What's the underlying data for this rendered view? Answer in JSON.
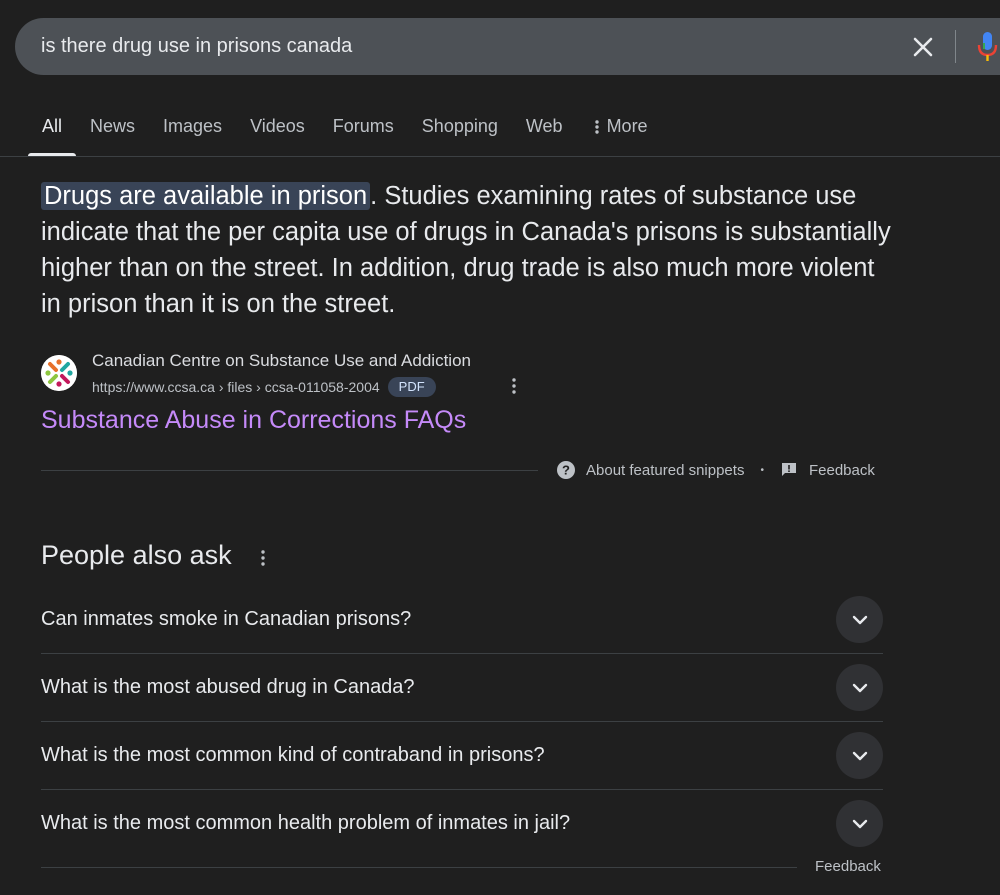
{
  "search": {
    "query": "is there drug use in prisons canada"
  },
  "tabs": [
    {
      "label": "All",
      "active": true
    },
    {
      "label": "News"
    },
    {
      "label": "Images"
    },
    {
      "label": "Videos"
    },
    {
      "label": "Forums"
    },
    {
      "label": "Shopping"
    },
    {
      "label": "Web"
    },
    {
      "label": "More",
      "icon": "more-vert-icon"
    }
  ],
  "snippet": {
    "highlight": "Drugs are available in prison",
    "text": ". Studies examining rates of substance use indicate that the per capita use of drugs in Canada's prisons is substantially higher than on the street. In addition, drug trade is also much more violent in prison than it is on the street.",
    "source_name": "Canadian Centre on Substance Use and Addiction",
    "source_url": "https://www.ccsa.ca › files › ccsa-011058-2004",
    "badge": "PDF",
    "title": "Substance Abuse in Corrections FAQs",
    "about_label": "About featured snippets",
    "separator": "•",
    "feedback_label": "Feedback"
  },
  "paa": {
    "title": "People also ask",
    "questions": [
      "Can inmates smoke in Canadian prisons?",
      "What is the most abused drug in Canada?",
      "What is the most common kind of contraband in prisons?",
      "What is the most common health problem of inmates in jail?"
    ],
    "feedback_label": "Feedback"
  },
  "colors": {
    "background": "#1f1f1f",
    "search_bar": "#4d5156",
    "link_visited": "#c58af9",
    "highlight": "#394457"
  }
}
